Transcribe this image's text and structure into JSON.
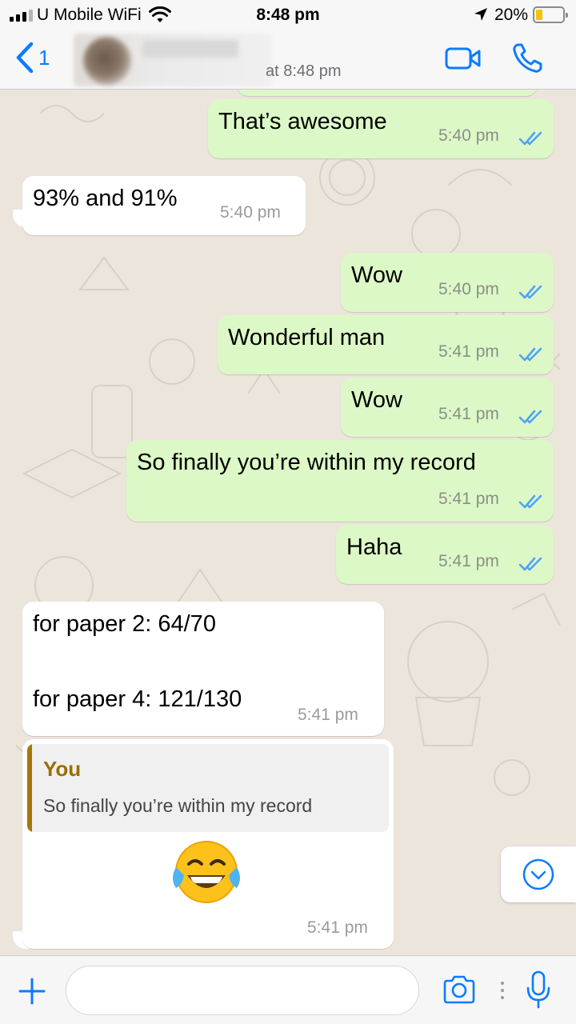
{
  "status_bar": {
    "carrier": "U Mobile WiFi",
    "time": "8:48 pm",
    "battery": "20%",
    "battery_level": 0.2,
    "icons": [
      "signal-icon",
      "wifi-icon",
      "location-arrow-icon",
      "battery-icon"
    ]
  },
  "header": {
    "back_count": "1",
    "last_seen": "at 8:48 pm",
    "icons": [
      "back-chevron-icon",
      "video-call-icon",
      "phone-icon"
    ]
  },
  "messages": [
    {
      "dir": "out",
      "text": "That’s awesome",
      "time": "5:40 pm",
      "status": "read"
    },
    {
      "dir": "in",
      "text": "93% and 91%",
      "time": "5:40 pm"
    },
    {
      "dir": "out",
      "text": "Wow",
      "time": "5:40 pm",
      "status": "read"
    },
    {
      "dir": "out",
      "text": "Wonderful man",
      "time": "5:41 pm",
      "status": "read"
    },
    {
      "dir": "out",
      "text": "Wow",
      "time": "5:41 pm",
      "status": "read"
    },
    {
      "dir": "out",
      "text": "So finally you’re within my record",
      "time": "5:41 pm",
      "status": "read"
    },
    {
      "dir": "out",
      "text": "Haha",
      "time": "5:41 pm",
      "status": "read"
    },
    {
      "dir": "in",
      "lines": [
        "for paper 2: 64/70",
        "for paper 4: 121/130"
      ],
      "time": "5:41 pm"
    },
    {
      "dir": "in",
      "reply": {
        "author": "You",
        "text": "So finally you’re within my record"
      },
      "emoji": "face-with-tears-of-joy",
      "time": "5:41 pm"
    }
  ],
  "input_bar": {
    "placeholder": "",
    "icons": [
      "plus-icon",
      "camera-icon",
      "microphone-icon"
    ]
  },
  "colors": {
    "accent": "#0a7cff",
    "outgoing_bubble": "#dcf8c6",
    "incoming_bubble": "#ffffff",
    "read_ticks": "#4fa3f7",
    "quote_bar": "#a5770a",
    "chat_background": "#ebe5dc"
  }
}
